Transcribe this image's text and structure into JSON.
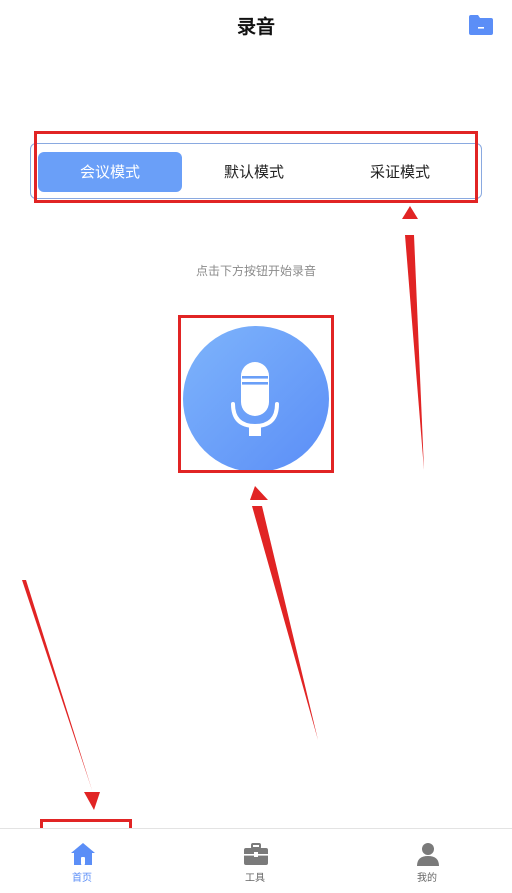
{
  "header": {
    "title": "录音"
  },
  "modes": {
    "items": [
      {
        "label": "会议模式",
        "selected": true
      },
      {
        "label": "默认模式",
        "selected": false
      },
      {
        "label": "采证模式",
        "selected": false
      }
    ]
  },
  "main": {
    "hint": "点击下方按钮开始录音"
  },
  "tabbar": {
    "items": [
      {
        "label": "首页",
        "icon": "home-icon",
        "active": true
      },
      {
        "label": "工具",
        "icon": "toolbox-icon",
        "active": false
      },
      {
        "label": "我的",
        "icon": "user-icon",
        "active": false
      }
    ]
  },
  "colors": {
    "accent": "#5b8ef7",
    "annotation": "#e12424"
  }
}
